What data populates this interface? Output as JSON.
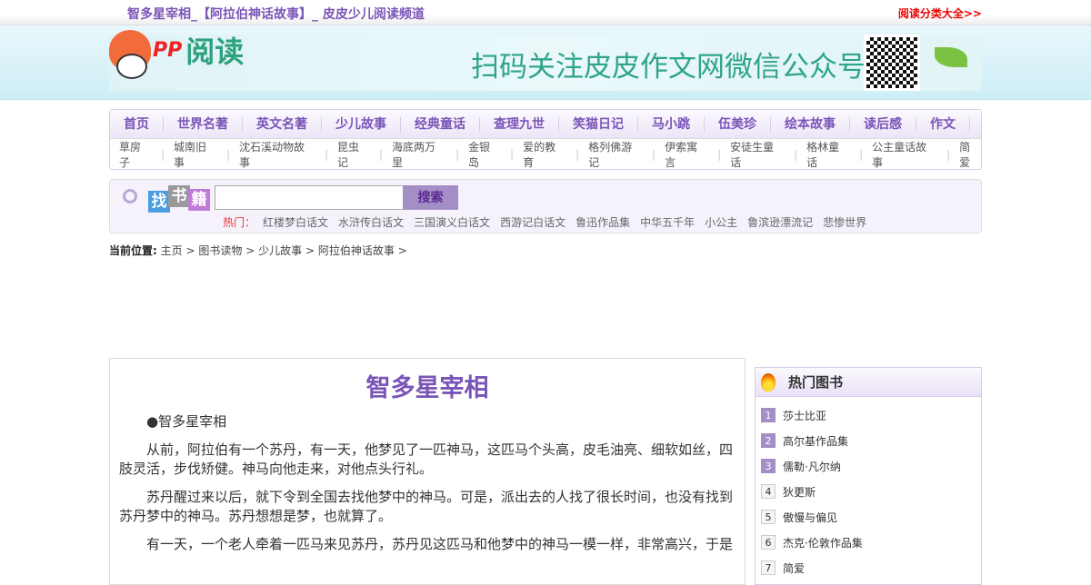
{
  "top": {
    "title": "智多星宰相_【阿拉伯神话故事】_ 皮皮少儿阅读频道",
    "right_link": "阅读分类大全>>"
  },
  "banner": {
    "logo_pp": "PP",
    "logo_text": "阅读",
    "slogan": "扫码关注皮皮作文网微信公众号"
  },
  "nav": {
    "main": [
      "首页",
      "世界名著",
      "英文名著",
      "少儿故事",
      "经典童话",
      "查理九世",
      "笑猫日记",
      "马小跳",
      "伍美珍",
      "绘本故事",
      "读后感",
      "作文"
    ],
    "sub": [
      "草房子",
      "城南旧事",
      "沈石溪动物故事",
      "昆虫记",
      "海底两万里",
      "金银岛",
      "爱的教育",
      "格列佛游记",
      "伊索寓言",
      "安徒生童话",
      "格林童话",
      "公主童话故事",
      "简爱"
    ]
  },
  "search": {
    "badge": [
      "找",
      "书",
      "籍"
    ],
    "button": "搜索",
    "value": "",
    "hot_label": "热门：",
    "hot": [
      "红楼梦白话文",
      "水浒传白话文",
      "三国演义白话文",
      "西游记白话文",
      "鲁迅作品集",
      "中华五千年",
      "小公主",
      "鲁滨逊漂流记",
      "悲惨世界"
    ]
  },
  "breadcrumb": {
    "label": "当前位置:",
    "items": [
      "主页",
      "图书读物",
      "少儿故事",
      "阿拉伯神话故事"
    ],
    "sep": ">"
  },
  "article": {
    "title": "智多星宰相",
    "paragraphs": [
      "●智多星宰相",
      "从前，阿拉伯有一个苏丹，有一天，他梦见了一匹神马，这匹马个头高，皮毛油亮、细软如丝，四肢灵活，步伐矫健。神马向他走来，对他点头行礼。",
      "苏丹醒过来以后，就下令到全国去找他梦中的神马。可是，派出去的人找了很长时间，也没有找到苏丹梦中的神马。苏丹想想是梦，也就算了。",
      "有一天，一个老人牵着一匹马来见苏丹，苏丹见这匹马和他梦中的神马一模一样，非常高兴，于是"
    ]
  },
  "sidebar": {
    "title": "热门图书",
    "items": [
      {
        "n": "1",
        "t": "莎士比亚"
      },
      {
        "n": "2",
        "t": "高尔基作品集"
      },
      {
        "n": "3",
        "t": "儒勒·凡尔纳"
      },
      {
        "n": "4",
        "t": "狄更斯"
      },
      {
        "n": "5",
        "t": "傲慢与偏见"
      },
      {
        "n": "6",
        "t": "杰克·伦敦作品集"
      },
      {
        "n": "7",
        "t": "简爱"
      }
    ]
  }
}
